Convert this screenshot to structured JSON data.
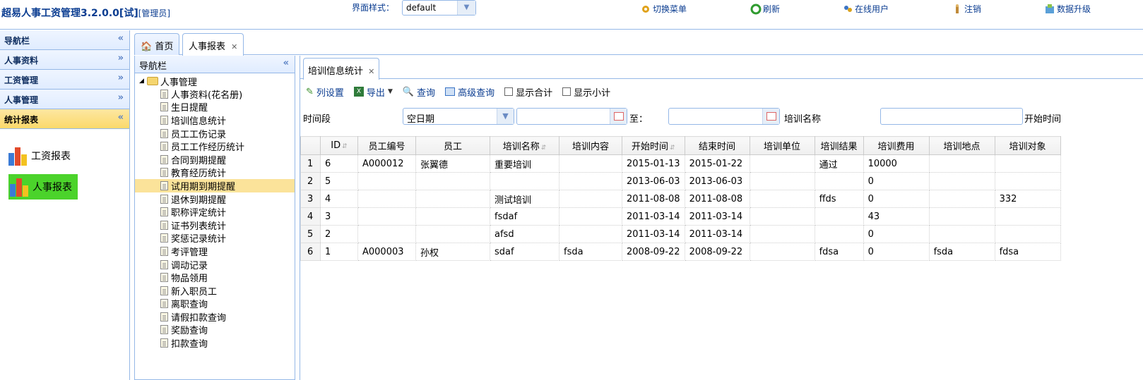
{
  "app": {
    "title": "超易人事工资管理3.2.0.0[试]",
    "role": "[管理员]"
  },
  "theme": {
    "label": "界面样式：",
    "value": "default"
  },
  "top_links": [
    {
      "label": "切换菜单",
      "icon": "gear-icon"
    },
    {
      "label": "刷新",
      "icon": "refresh-icon"
    },
    {
      "label": "在线用户",
      "icon": "users-icon"
    },
    {
      "label": "注销",
      "icon": "logout-icon"
    },
    {
      "label": "数据升级",
      "icon": "upgrade-icon"
    }
  ],
  "nav": {
    "title": "导航栏",
    "sections": [
      "人事资料",
      "工资管理",
      "人事管理",
      "统计报表"
    ],
    "reports": [
      "工资报表",
      "人事报表"
    ]
  },
  "tabs": [
    {
      "label": "首页"
    },
    {
      "label": "人事报表"
    }
  ],
  "tree": {
    "title": "导航栏",
    "root": "人事管理",
    "items": [
      "人事资料(花名册)",
      "生日提醒",
      "培训信息统计",
      "员工工伤记录",
      "员工工作经历统计",
      "合同到期提醒",
      "教育经历统计",
      "试用期到期提醒",
      "退休到期提醒",
      "职称评定统计",
      "证书列表统计",
      "奖惩记录统计",
      "考评管理",
      "调动记录",
      "物品领用",
      "新入职员工",
      "离职查询",
      "请假扣款查询",
      "奖励查询",
      "扣款查询"
    ]
  },
  "sub_tab": "培训信息统计",
  "toolbar": {
    "columns": "列设置",
    "export": "导出",
    "query": "查询",
    "advanced": "高级查询",
    "show_total": "显示合计",
    "show_subtotal": "显示小计"
  },
  "filter": {
    "period_label": "时间段",
    "period_value": "空日期",
    "to_label": "至：",
    "name_label": "培训名称",
    "start_label": "开始时间"
  },
  "grid": {
    "headers": [
      "ID",
      "员工编号",
      "员工",
      "培训名称",
      "培训内容",
      "开始时间",
      "结束时间",
      "培训单位",
      "培训结果",
      "培训费用",
      "培训地点",
      "培训对象"
    ],
    "rows": [
      [
        "1",
        "6",
        "A000012",
        "张翼德",
        "重要培训",
        "",
        "2015-01-13",
        "2015-01-22",
        "",
        "通过",
        "10000",
        "",
        ""
      ],
      [
        "2",
        "5",
        "",
        "",
        "",
        "",
        "2013-06-03",
        "2013-06-03",
        "",
        "",
        "0",
        "",
        ""
      ],
      [
        "3",
        "4",
        "",
        "",
        "测试培训",
        "",
        "2011-08-08",
        "2011-08-08",
        "",
        "ffds",
        "0",
        "",
        "332"
      ],
      [
        "4",
        "3",
        "",
        "",
        "fsdaf",
        "",
        "2011-03-14",
        "2011-03-14",
        "",
        "",
        "43",
        "",
        ""
      ],
      [
        "5",
        "2",
        "",
        "",
        "afsd",
        "",
        "2011-03-14",
        "2011-03-14",
        "",
        "",
        "0",
        "",
        ""
      ],
      [
        "6",
        "1",
        "A000003",
        "孙权",
        "sdaf",
        "fsda",
        "2008-09-22",
        "2008-09-22",
        "",
        "fdsa",
        "0",
        "fsda",
        "fdsa"
      ]
    ]
  }
}
